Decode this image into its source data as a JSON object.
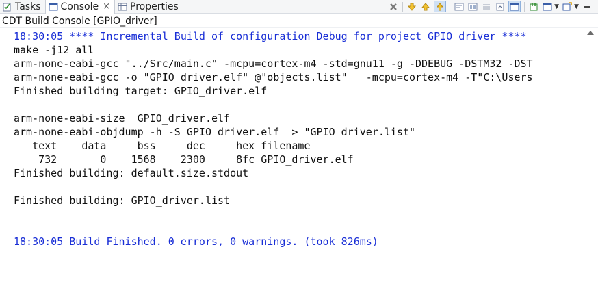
{
  "tabs": [
    {
      "label": "Tasks",
      "icon": "tasks-icon",
      "active": false
    },
    {
      "label": "Console",
      "icon": "console-icon",
      "active": true,
      "closable": true
    },
    {
      "label": "Properties",
      "icon": "properties-icon",
      "active": false
    }
  ],
  "toolbar_icons": [
    "remove-launch-icon",
    "scroll-down-icon",
    "scroll-up-icon",
    "scroll-lock-icon",
    "word-wrap-icon",
    "show-console-on-output-icon",
    "clear-console-icon",
    "pin-console-icon",
    "display-selected-console-icon",
    "open-console-icon",
    "minimize-icon"
  ],
  "console_title": "CDT Build Console [GPIO_driver]",
  "console_lines": [
    {
      "text": "18:30:05 **** Incremental Build of configuration Debug for project GPIO_driver ****",
      "color": "#1a2fd6"
    },
    {
      "text": "make -j12 all",
      "color": "#111111"
    },
    {
      "text": "arm-none-eabi-gcc \"../Src/main.c\" -mcpu=cortex-m4 -std=gnu11 -g -DDEBUG -DSTM32 -DST",
      "color": "#111111"
    },
    {
      "text": "arm-none-eabi-gcc -o \"GPIO_driver.elf\" @\"objects.list\"   -mcpu=cortex-m4 -T\"C:\\Users",
      "color": "#111111"
    },
    {
      "text": "Finished building target: GPIO_driver.elf",
      "color": "#111111"
    },
    {
      "text": " ",
      "color": "#111111"
    },
    {
      "text": "arm-none-eabi-size  GPIO_driver.elf",
      "color": "#111111"
    },
    {
      "text": "arm-none-eabi-objdump -h -S GPIO_driver.elf  > \"GPIO_driver.list\"",
      "color": "#111111"
    },
    {
      "text": "   text    data     bss     dec     hex filename",
      "color": "#111111"
    },
    {
      "text": "    732       0    1568    2300     8fc GPIO_driver.elf",
      "color": "#111111"
    },
    {
      "text": "Finished building: default.size.stdout",
      "color": "#111111"
    },
    {
      "text": " ",
      "color": "#111111"
    },
    {
      "text": "Finished building: GPIO_driver.list",
      "color": "#111111"
    },
    {
      "text": " ",
      "color": "#111111"
    },
    {
      "text": " ",
      "color": "#111111"
    },
    {
      "text": "18:30:05 Build Finished. 0 errors, 0 warnings. (took 826ms)",
      "color": "#1a2fd6"
    }
  ]
}
